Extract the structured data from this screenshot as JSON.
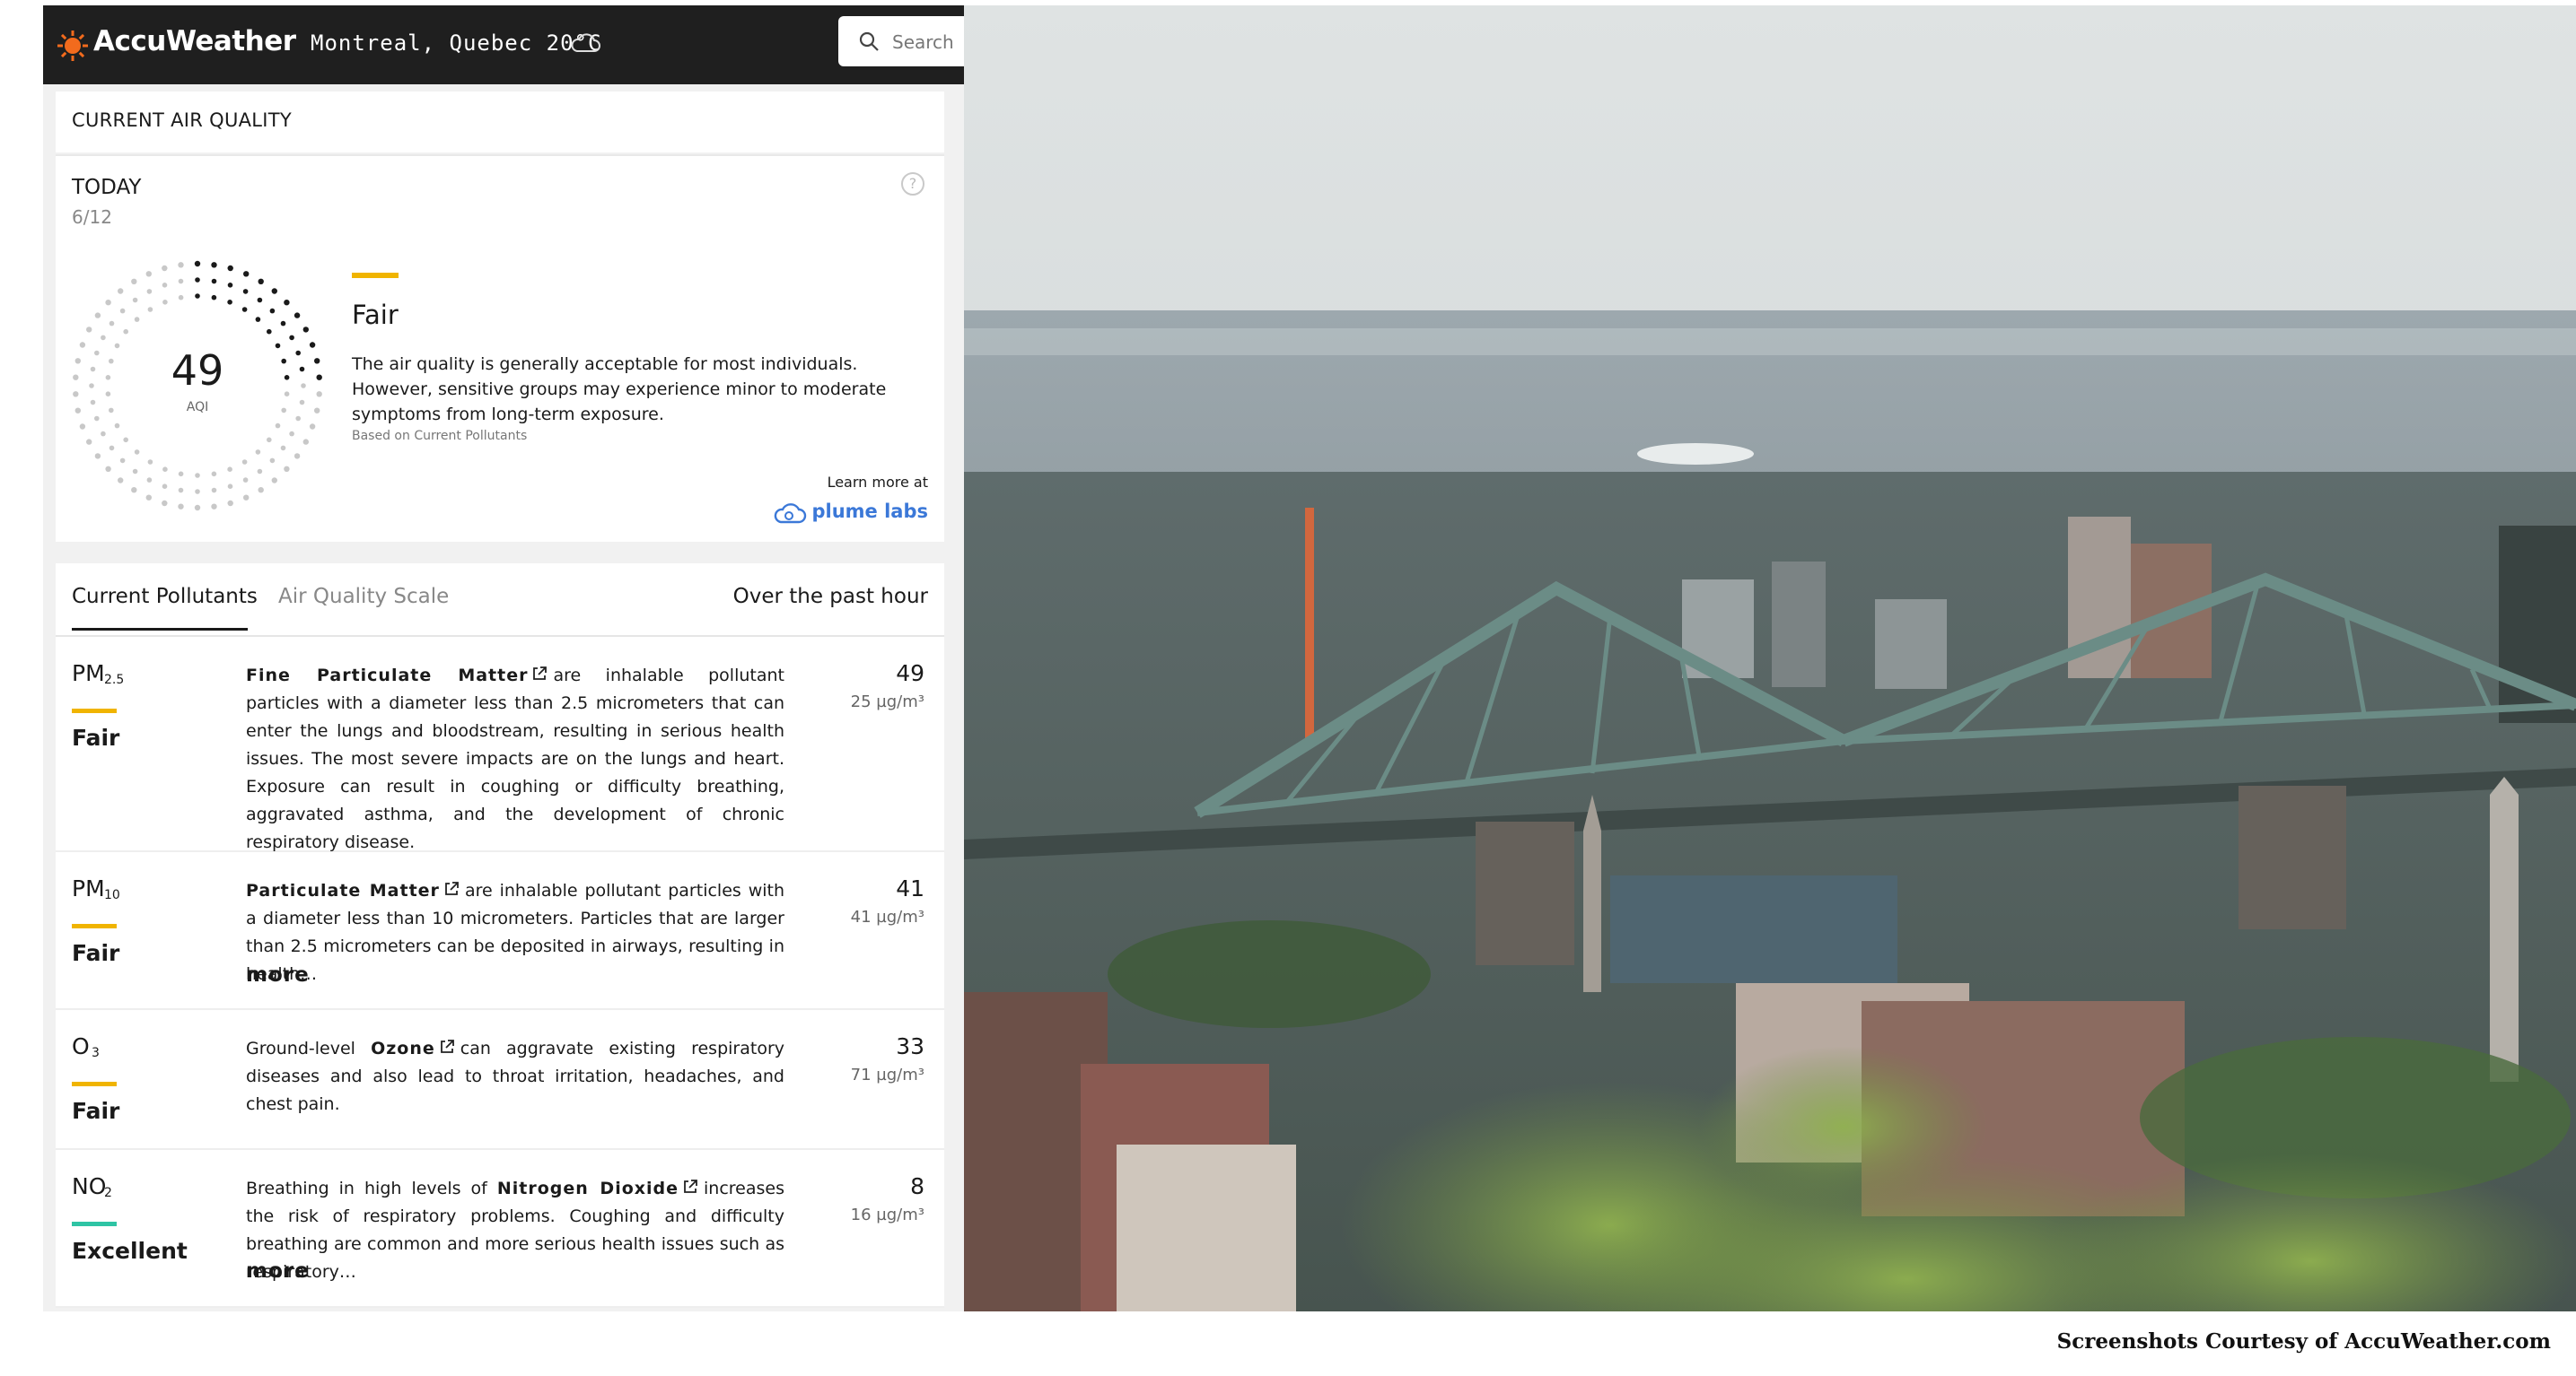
{
  "header": {
    "brand": "AccuWeather",
    "location": "Montreal, Quebec 20°C",
    "search_placeholder": "Search"
  },
  "current_air_quality": {
    "heading": "CURRENT AIR QUALITY"
  },
  "today": {
    "label": "TODAY",
    "date": "6/12",
    "aqi": "49",
    "aqi_label": "AQI",
    "aqi_fraction": 0.245,
    "category": "Fair",
    "description": "The air quality is generally acceptable for most individuals. However, sensitive groups may experience minor to moderate symptoms from long-term exposure.",
    "basis": "Based on Current Pollutants",
    "learn_more": "Learn more at",
    "partner": "plume labs"
  },
  "pollutants": {
    "tabs": [
      "Current Pollutants",
      "Air Quality Scale"
    ],
    "period": "Over the past hour",
    "more_label": "more",
    "items": [
      {
        "symbol": "PM",
        "sub": "2.5",
        "category": "Fair",
        "color": "#f0b400",
        "desc_pre": "",
        "name": "Fine Particulate Matter",
        "desc_post": "are inhalable pollutant particles with a diameter less than 2.5 micrometers that can enter the lungs and bloodstream, resulting in serious health issues. The most severe impacts are on the lungs and heart. Exposure can result in coughing or difficulty breathing, aggravated asthma, and the development of chronic respiratory disease.",
        "value": "49",
        "unit": "25 µg/m³"
      },
      {
        "symbol": "PM",
        "sub": "10",
        "category": "Fair",
        "color": "#f0b400",
        "desc_pre": "",
        "name": "Particulate Matter",
        "desc_post": "are inhalable pollutant particles with a diameter less than 10 micrometers. Particles that are larger than 2.5 micrometers can be deposited in airways, resulting in health…",
        "value": "41",
        "unit": "41 µg/m³"
      },
      {
        "symbol": "O",
        "sub": "3",
        "category": "Fair",
        "color": "#f0b400",
        "desc_pre": "Ground-level",
        "name": "Ozone",
        "desc_post": "can aggravate existing respiratory diseases and also lead to throat irritation, headaches, and chest pain.",
        "value": "33",
        "unit": "71 µg/m³"
      },
      {
        "symbol": "NO",
        "sub": "2",
        "category": "Excellent",
        "color": "#2ec4a4",
        "desc_pre": "Breathing in high levels of",
        "name": "Nitrogen Dioxide",
        "desc_post": "increases the risk of respiratory problems. Coughing and difficulty breathing are common and more serious health issues such as respiratory…",
        "value": "8",
        "unit": "16 µg/m³"
      }
    ]
  },
  "credit": "Screenshots Courtesy of AccuWeather.com",
  "colors": {
    "brand_orange": "#f26b1d",
    "fair": "#f0b400",
    "excellent": "#2ec4a4",
    "link_blue": "#3b78d8"
  }
}
